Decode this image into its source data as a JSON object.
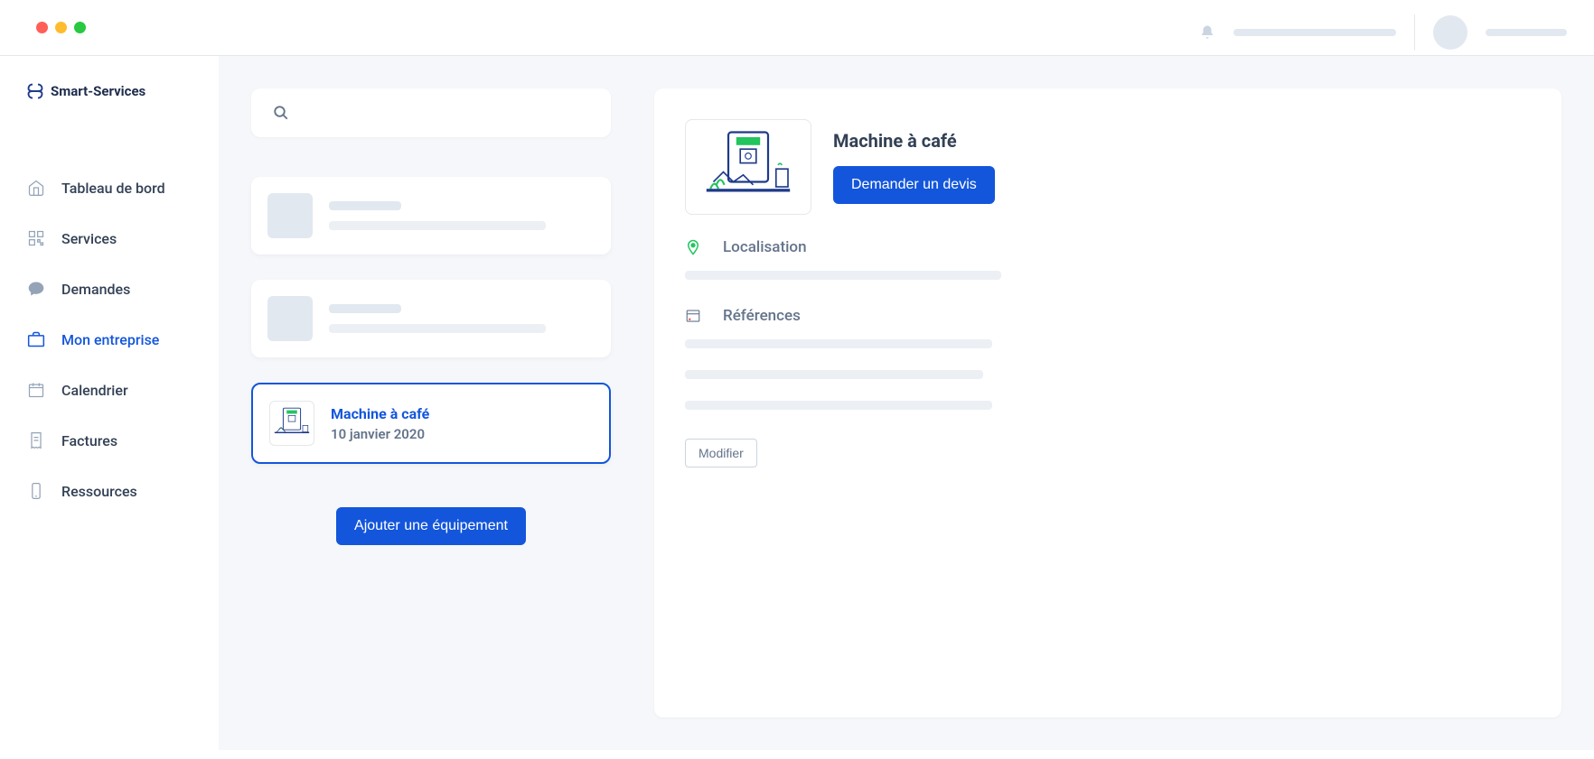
{
  "brand": {
    "name": "Smart-Services"
  },
  "sidebar": {
    "items": [
      {
        "label": "Tableau de bord",
        "icon": "home-icon"
      },
      {
        "label": "Services",
        "icon": "qr-icon"
      },
      {
        "label": "Demandes",
        "icon": "chat-icon"
      },
      {
        "label": "Mon entreprise",
        "icon": "briefcase-icon"
      },
      {
        "label": "Calendrier",
        "icon": "calendar-icon"
      },
      {
        "label": "Factures",
        "icon": "receipt-icon"
      },
      {
        "label": "Ressources",
        "icon": "phone-icon"
      }
    ],
    "activeIndex": 3
  },
  "equipment_list": {
    "selected": {
      "title": "Machine à café",
      "date": "10 janvier 2020"
    },
    "add_button": "Ajouter une équipement"
  },
  "detail": {
    "title": "Machine à café",
    "request_quote_button": "Demander un devis",
    "location_label": "Localisation",
    "references_label": "Références",
    "edit_button": "Modifier"
  }
}
